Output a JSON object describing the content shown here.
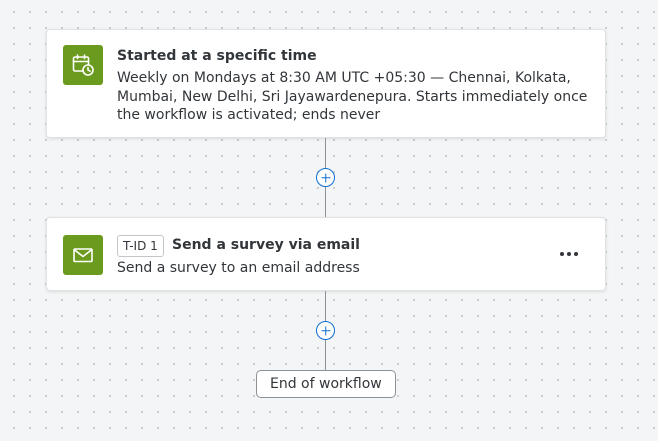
{
  "trigger": {
    "icon": "calendar-clock-icon",
    "title": "Started at a specific time",
    "description": "Weekly on Mondays at 8:30 AM UTC +05:30 — Chennai, Kolkata, Mumbai, New Delhi, Sri Jayawardenepura. Starts immediately once the workflow is activated; ends never"
  },
  "task": {
    "icon": "email-icon",
    "task_id": "T-ID 1",
    "title": "Send a survey via email",
    "description": "Send a survey to an email address",
    "more_icon": "more-options-icon"
  },
  "add_step_icon": "plus-circle-icon",
  "end": {
    "label": "End of workflow"
  },
  "colors": {
    "icon_tile": "#6a9a1e",
    "accent": "#0a6ed1",
    "background": "#f4f5f6",
    "text": "#32363a"
  }
}
